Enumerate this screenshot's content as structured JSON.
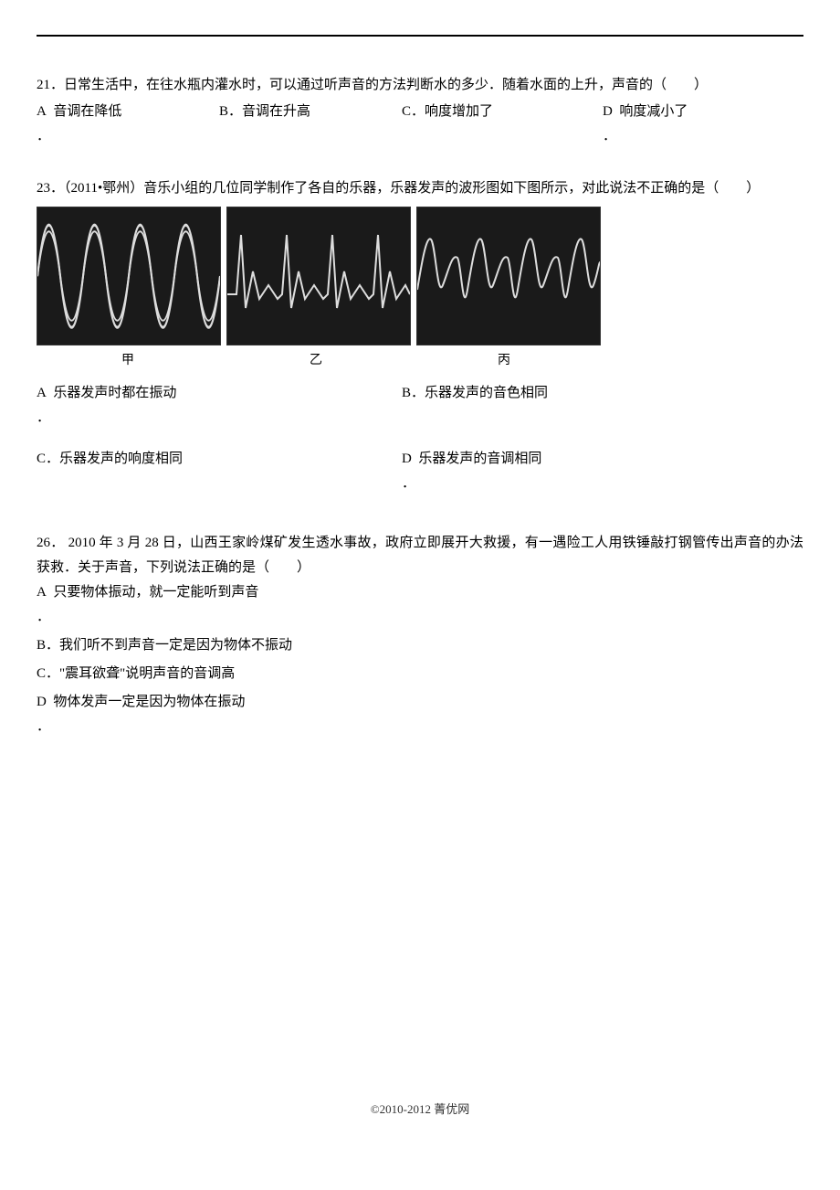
{
  "q21": {
    "number": "21．",
    "text": "日常生活中，在往水瓶内灌水时，可以通过听声音的方法判断水的多少．随着水面的上升，声音的（　　）",
    "options": {
      "A": {
        "label": "A",
        "dot": "．",
        "text": "音调在降低"
      },
      "B": {
        "label": "B．",
        "text": "音调在升高"
      },
      "C": {
        "label": "C．",
        "text": "响度增加了"
      },
      "D": {
        "label": "D",
        "dot": "．",
        "text": "响度减小了"
      }
    }
  },
  "q23": {
    "number": "23．",
    "text": "（2011•鄂州）音乐小组的几位同学制作了各自的乐器，乐器发声的波形图如下图所示，对此说法不正确的是（　　）",
    "wave_labels": {
      "a": "甲",
      "b": "乙",
      "c": "丙"
    },
    "options": {
      "A": {
        "label": "A",
        "dot": "．",
        "text": "乐器发声时都在振动"
      },
      "B": {
        "label": "B．",
        "text": "乐器发声的音色相同"
      },
      "C": {
        "label": "C．",
        "text": "乐器发声的响度相同"
      },
      "D": {
        "label": "D",
        "dot": "．",
        "text": "乐器发声的音调相同"
      }
    }
  },
  "q26": {
    "number": "26．",
    "text": " 2010 年 3 月 28 日，山西王家岭煤矿发生透水事故，政府立即展开大救援，有一遇险工人用铁锤敲打钢管传出声音的办法获救．关于声音，下列说法正确的是（　　）",
    "options": {
      "A": {
        "label": "A",
        "dot": "．",
        "text": "只要物体振动，就一定能听到声音"
      },
      "B": {
        "label": "B．",
        "text": "我们听不到声音一定是因为物体不振动"
      },
      "C": {
        "label": "C．",
        "text": "\"震耳欲聋\"说明声音的音调高"
      },
      "D": {
        "label": "D",
        "dot": "．",
        "text": "物体发声一定是因为物体在振动"
      }
    }
  },
  "footer": "©2010-2012  菁优网"
}
